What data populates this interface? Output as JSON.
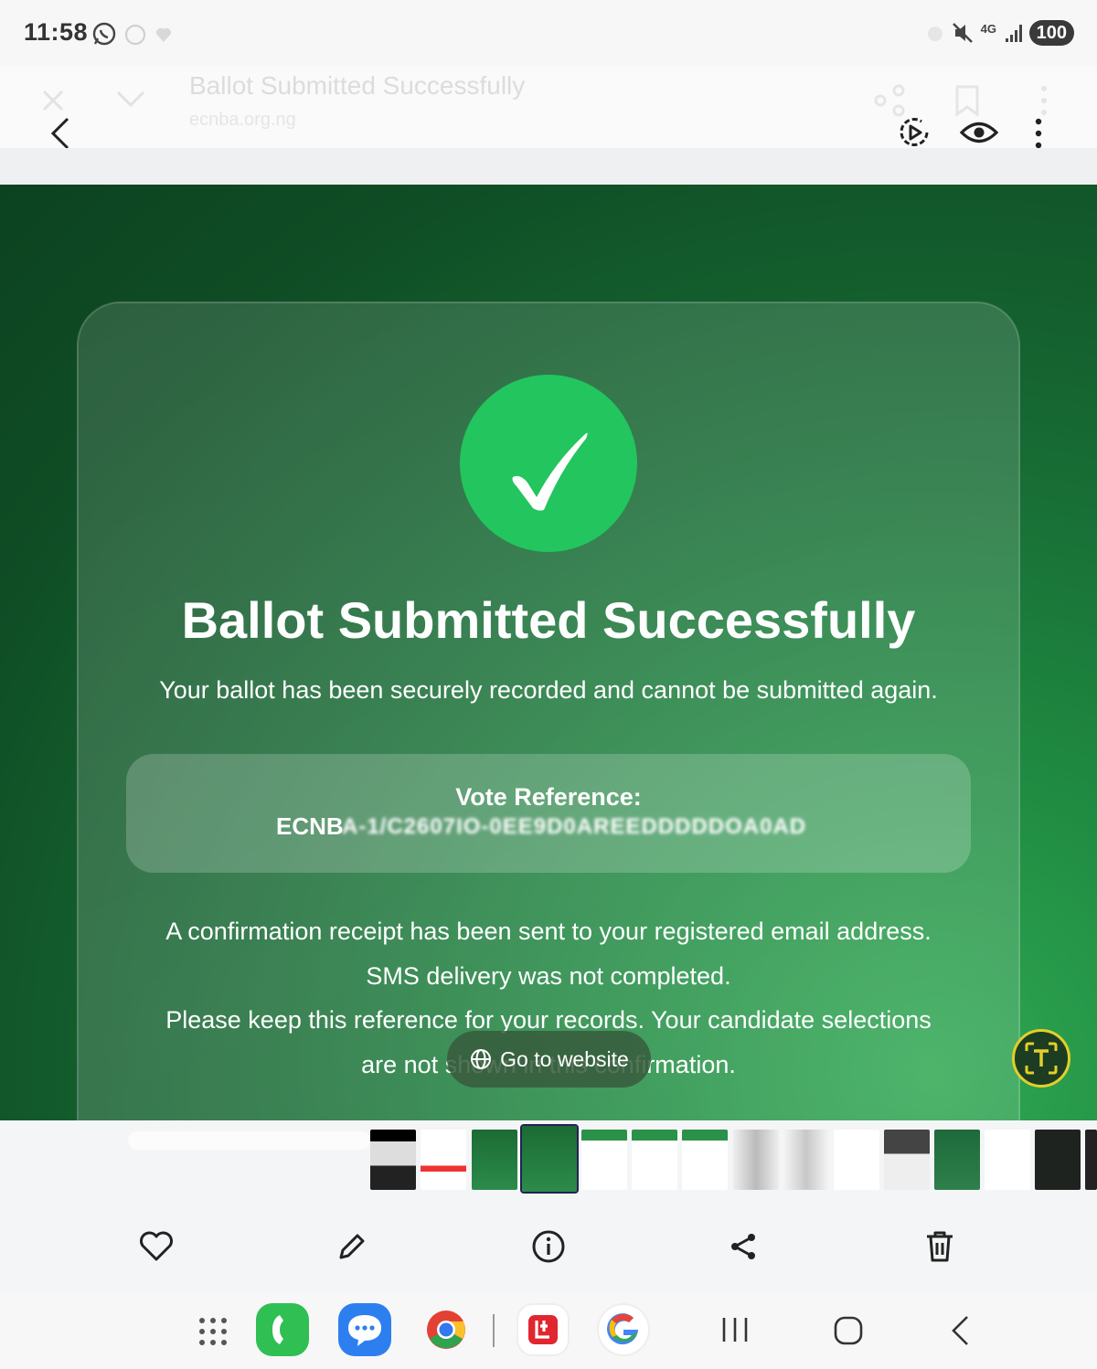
{
  "status_bar": {
    "time": "11:58",
    "network": "4G",
    "battery": "100"
  },
  "viewer": {
    "ghost_title": "Ballot Submitted Successfully",
    "ghost_url": "ecnba.org.ng"
  },
  "page": {
    "heading": "Ballot Submitted Successfully",
    "subheading": "Your ballot has been securely recorded and cannot be submitted again.",
    "reference_label": "Vote Reference:",
    "reference_prefix": "ECNB",
    "reference_obscured": "A-1/C2607IO-0EE9D0AREEDDDDDOA0AD",
    "paragraph_1": "A confirmation receipt has been sent to your registered email address.",
    "paragraph_2": "SMS delivery was not completed.",
    "paragraph_3": "Please keep this reference for your records. Your candidate selections",
    "paragraph_4": "are not shown in this confirmation."
  },
  "overlay": {
    "go_to_website": "Go to website"
  },
  "icons": {
    "back": "chevron-left-icon",
    "motion": "motion-photo-icon",
    "eye": "eye-icon",
    "more": "more-vert-icon",
    "favorite": "heart-icon",
    "edit": "pencil-icon",
    "info": "info-icon",
    "share": "share-icon",
    "delete": "trash-icon"
  },
  "colors": {
    "success_green": "#22c55e",
    "background_dark_green": "#0f4d25",
    "text_extract_ring": "#e3cf2a"
  }
}
